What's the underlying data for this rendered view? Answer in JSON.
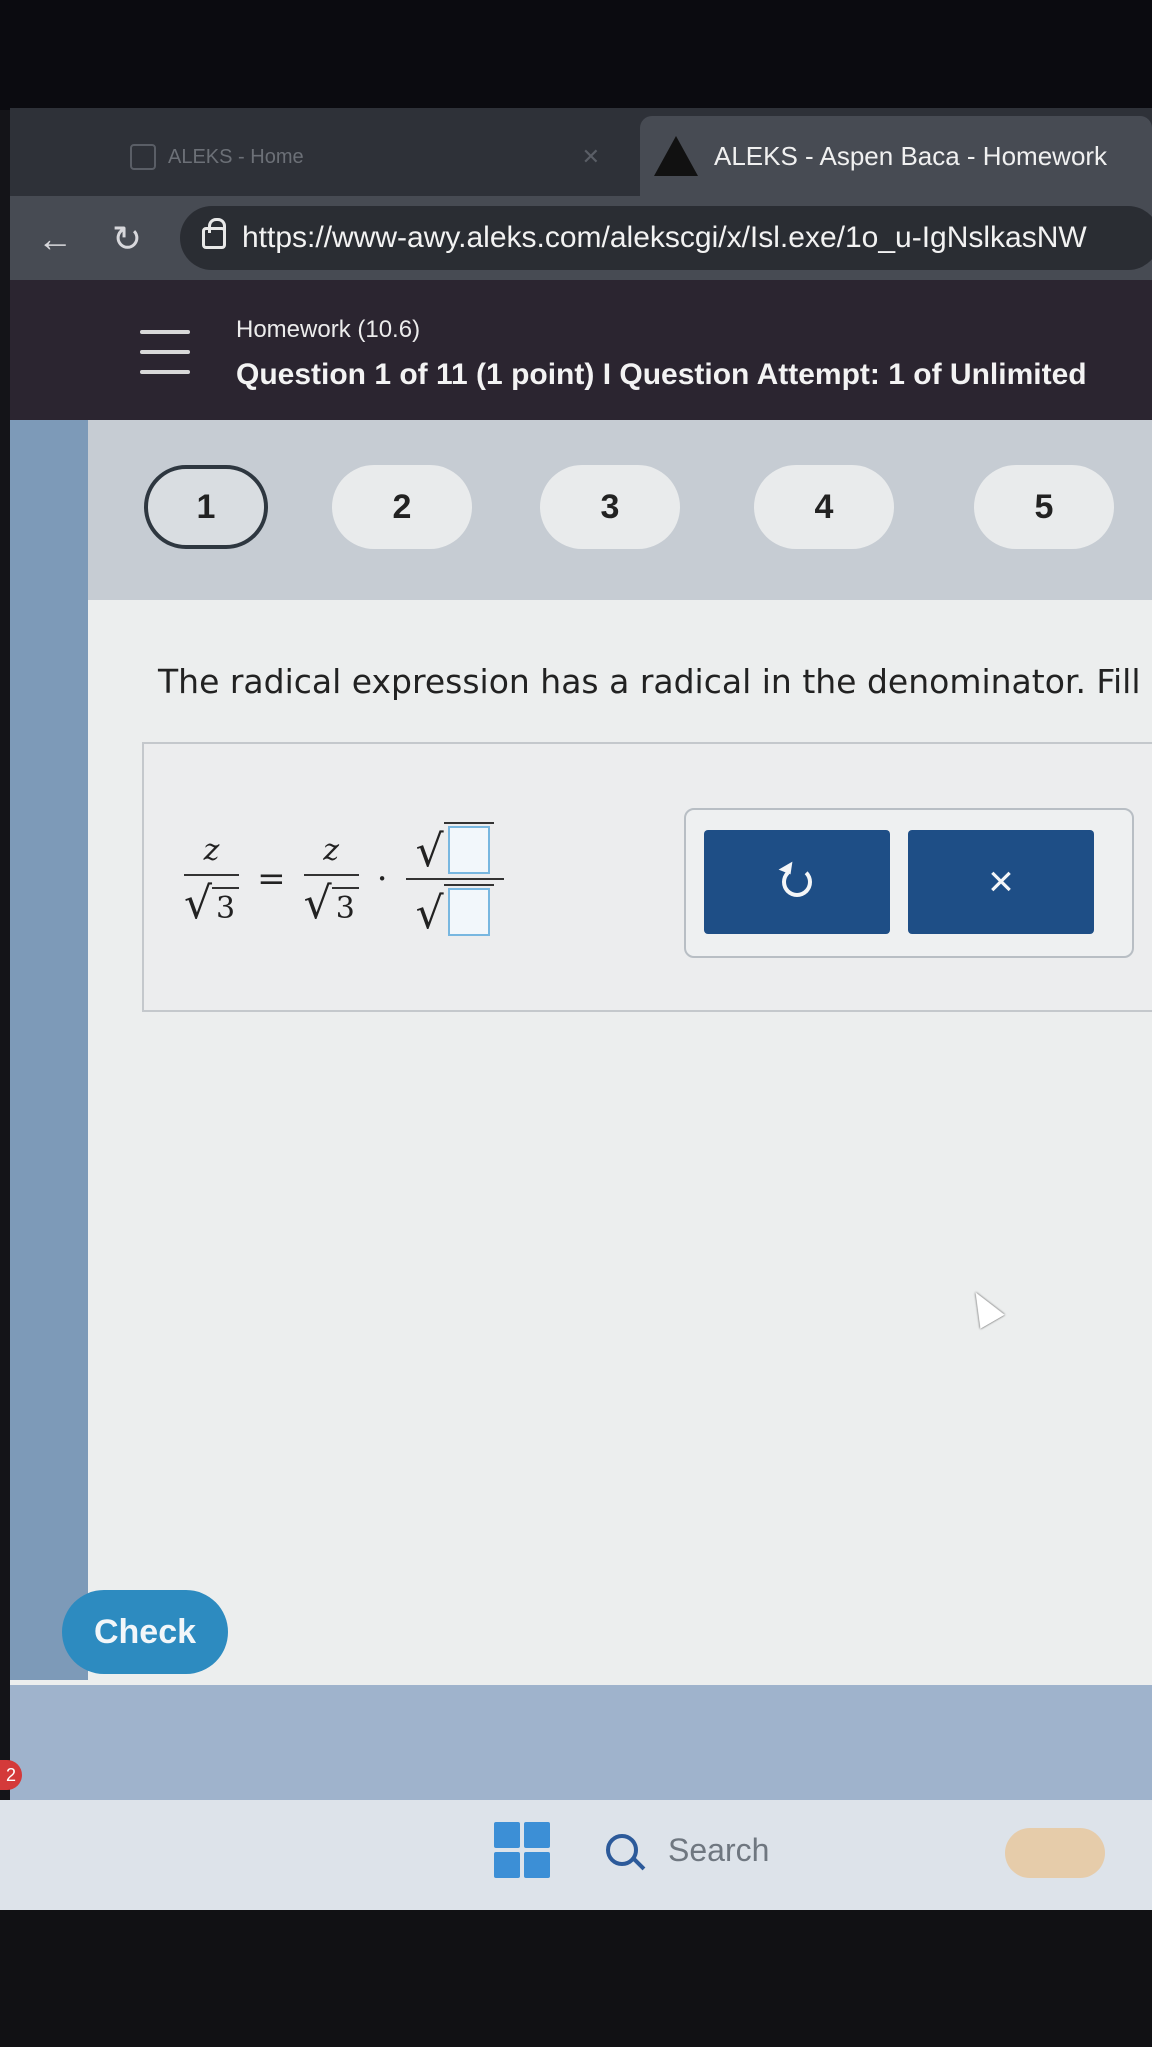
{
  "browser": {
    "inactive_tab": {
      "label": "ALEKS - Home"
    },
    "active_tab": {
      "label": "ALEKS - Aspen Baca - Homework"
    },
    "url": "https://www-awy.aleks.com/alekscgi/x/Isl.exe/1o_u-IgNslkasNW"
  },
  "header": {
    "title": "Homework (10.6)",
    "subtitle": "Question 1 of 11 (1 point)  I  Question Attempt: 1 of Unlimited"
  },
  "question_nav": {
    "items": [
      {
        "label": "1",
        "active": true
      },
      {
        "label": "2"
      },
      {
        "label": "3"
      },
      {
        "label": "4"
      },
      {
        "label": "5"
      }
    ]
  },
  "question": {
    "prompt": "The radical expression has a radical in the denominator. Fill i",
    "expr": {
      "numerator": "z",
      "radicand": "3",
      "equals": "=",
      "times": "·"
    }
  },
  "buttons": {
    "clear": "×",
    "check": "Check"
  },
  "taskbar": {
    "search": "Search",
    "badge": "2"
  }
}
